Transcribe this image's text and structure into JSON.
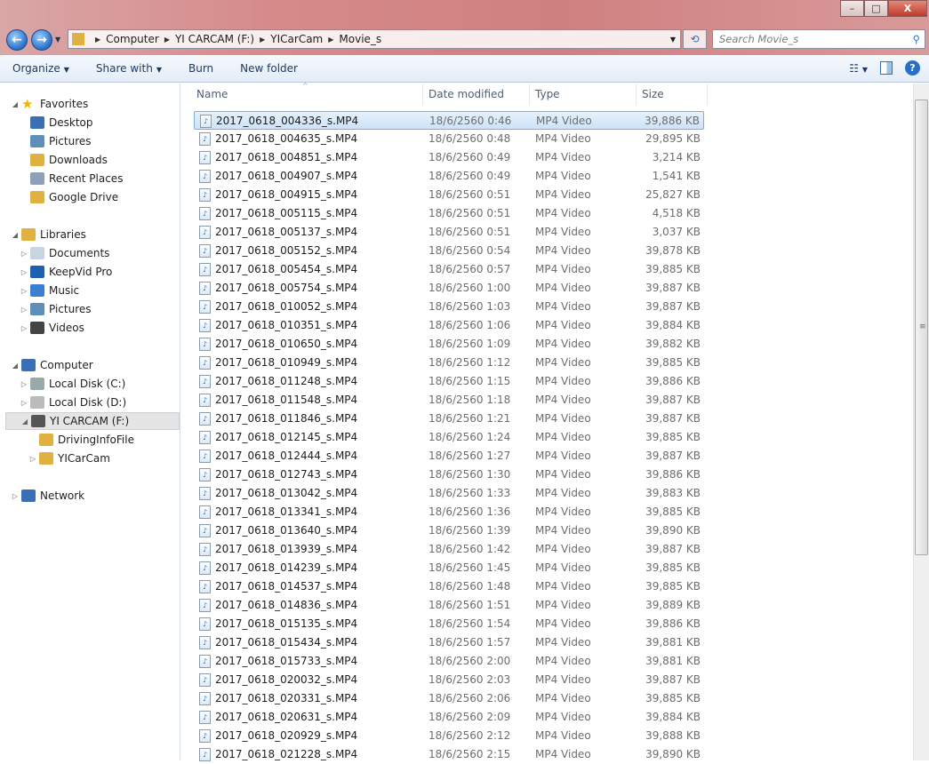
{
  "window": {
    "min": "–",
    "max": "□",
    "close": "X"
  },
  "nav": {
    "back": "←",
    "forward": "→"
  },
  "address": {
    "crumbs": [
      "Computer",
      "YI CARCAM (F:)",
      "YICarCam",
      "Movie_s"
    ]
  },
  "search": {
    "placeholder": "Search Movie_s"
  },
  "toolbar": {
    "organize": "Organize",
    "share": "Share with",
    "burn": "Burn",
    "new_folder": "New folder"
  },
  "sidebar": [
    {
      "label": "Favorites",
      "level": 0,
      "tri": "◢",
      "icon": "star",
      "color": "#f2b600",
      "gap": 0
    },
    {
      "label": "Desktop",
      "level": 1,
      "icon": "desktop",
      "color": "#3a6fb5"
    },
    {
      "label": "Pictures",
      "level": 1,
      "icon": "pictures",
      "color": "#5f8fb8"
    },
    {
      "label": "Downloads",
      "level": 1,
      "icon": "downloads",
      "color": "#e0b040"
    },
    {
      "label": "Recent Places",
      "level": 1,
      "icon": "recent",
      "color": "#8ca0b8"
    },
    {
      "label": "Google Drive",
      "level": 1,
      "icon": "folder",
      "color": "#e0b040"
    },
    {
      "label": "Libraries",
      "level": 0,
      "tri": "◢",
      "icon": "library",
      "color": "#e0b040",
      "gap": 1
    },
    {
      "label": "Documents",
      "level": 1,
      "tri": "▷",
      "icon": "documents",
      "color": "#c8d4e0"
    },
    {
      "label": "KeepVid Pro",
      "level": 1,
      "tri": "▷",
      "icon": "keepvid",
      "color": "#1f5fb0"
    },
    {
      "label": "Music",
      "level": 1,
      "tri": "▷",
      "icon": "music",
      "color": "#3a7fd0"
    },
    {
      "label": "Pictures",
      "level": 1,
      "tri": "▷",
      "icon": "pictures",
      "color": "#5f8fb8"
    },
    {
      "label": "Videos",
      "level": 1,
      "tri": "▷",
      "icon": "videos",
      "color": "#444"
    },
    {
      "label": "Computer",
      "level": 0,
      "tri": "◢",
      "icon": "computer",
      "color": "#3a6fb5",
      "gap": 1
    },
    {
      "label": "Local Disk (C:)",
      "level": 1,
      "tri": "▷",
      "icon": "drive",
      "color": "#9aa"
    },
    {
      "label": "Local Disk (D:)",
      "level": 1,
      "tri": "▷",
      "icon": "drive",
      "color": "#bbb"
    },
    {
      "label": "YI CARCAM (F:)",
      "level": 1,
      "tri": "◢",
      "icon": "usb-drive",
      "color": "#555",
      "selected": true
    },
    {
      "label": "DrivingInfoFile",
      "level": 2,
      "icon": "folder",
      "color": "#e0b040"
    },
    {
      "label": "YICarCam",
      "level": 2,
      "tri": "▷",
      "icon": "folder",
      "color": "#e0b040"
    },
    {
      "label": "Network",
      "level": 0,
      "tri": "▷",
      "icon": "network",
      "color": "#3a6fb5",
      "gap": 1
    }
  ],
  "columns": {
    "name": "Name",
    "date": "Date modified",
    "type": "Type",
    "size": "Size"
  },
  "files": [
    [
      "2017_0618_004336_s.MP4",
      "18/6/2560 0:46",
      "MP4 Video",
      "39,886 KB"
    ],
    [
      "2017_0618_004635_s.MP4",
      "18/6/2560 0:48",
      "MP4 Video",
      "29,895 KB"
    ],
    [
      "2017_0618_004851_s.MP4",
      "18/6/2560 0:49",
      "MP4 Video",
      "3,214 KB"
    ],
    [
      "2017_0618_004907_s.MP4",
      "18/6/2560 0:49",
      "MP4 Video",
      "1,541 KB"
    ],
    [
      "2017_0618_004915_s.MP4",
      "18/6/2560 0:51",
      "MP4 Video",
      "25,827 KB"
    ],
    [
      "2017_0618_005115_s.MP4",
      "18/6/2560 0:51",
      "MP4 Video",
      "4,518 KB"
    ],
    [
      "2017_0618_005137_s.MP4",
      "18/6/2560 0:51",
      "MP4 Video",
      "3,037 KB"
    ],
    [
      "2017_0618_005152_s.MP4",
      "18/6/2560 0:54",
      "MP4 Video",
      "39,878 KB"
    ],
    [
      "2017_0618_005454_s.MP4",
      "18/6/2560 0:57",
      "MP4 Video",
      "39,885 KB"
    ],
    [
      "2017_0618_005754_s.MP4",
      "18/6/2560 1:00",
      "MP4 Video",
      "39,887 KB"
    ],
    [
      "2017_0618_010052_s.MP4",
      "18/6/2560 1:03",
      "MP4 Video",
      "39,887 KB"
    ],
    [
      "2017_0618_010351_s.MP4",
      "18/6/2560 1:06",
      "MP4 Video",
      "39,884 KB"
    ],
    [
      "2017_0618_010650_s.MP4",
      "18/6/2560 1:09",
      "MP4 Video",
      "39,882 KB"
    ],
    [
      "2017_0618_010949_s.MP4",
      "18/6/2560 1:12",
      "MP4 Video",
      "39,885 KB"
    ],
    [
      "2017_0618_011248_s.MP4",
      "18/6/2560 1:15",
      "MP4 Video",
      "39,886 KB"
    ],
    [
      "2017_0618_011548_s.MP4",
      "18/6/2560 1:18",
      "MP4 Video",
      "39,887 KB"
    ],
    [
      "2017_0618_011846_s.MP4",
      "18/6/2560 1:21",
      "MP4 Video",
      "39,887 KB"
    ],
    [
      "2017_0618_012145_s.MP4",
      "18/6/2560 1:24",
      "MP4 Video",
      "39,885 KB"
    ],
    [
      "2017_0618_012444_s.MP4",
      "18/6/2560 1:27",
      "MP4 Video",
      "39,887 KB"
    ],
    [
      "2017_0618_012743_s.MP4",
      "18/6/2560 1:30",
      "MP4 Video",
      "39,886 KB"
    ],
    [
      "2017_0618_013042_s.MP4",
      "18/6/2560 1:33",
      "MP4 Video",
      "39,883 KB"
    ],
    [
      "2017_0618_013341_s.MP4",
      "18/6/2560 1:36",
      "MP4 Video",
      "39,885 KB"
    ],
    [
      "2017_0618_013640_s.MP4",
      "18/6/2560 1:39",
      "MP4 Video",
      "39,890 KB"
    ],
    [
      "2017_0618_013939_s.MP4",
      "18/6/2560 1:42",
      "MP4 Video",
      "39,887 KB"
    ],
    [
      "2017_0618_014239_s.MP4",
      "18/6/2560 1:45",
      "MP4 Video",
      "39,885 KB"
    ],
    [
      "2017_0618_014537_s.MP4",
      "18/6/2560 1:48",
      "MP4 Video",
      "39,885 KB"
    ],
    [
      "2017_0618_014836_s.MP4",
      "18/6/2560 1:51",
      "MP4 Video",
      "39,889 KB"
    ],
    [
      "2017_0618_015135_s.MP4",
      "18/6/2560 1:54",
      "MP4 Video",
      "39,886 KB"
    ],
    [
      "2017_0618_015434_s.MP4",
      "18/6/2560 1:57",
      "MP4 Video",
      "39,881 KB"
    ],
    [
      "2017_0618_015733_s.MP4",
      "18/6/2560 2:00",
      "MP4 Video",
      "39,881 KB"
    ],
    [
      "2017_0618_020032_s.MP4",
      "18/6/2560 2:03",
      "MP4 Video",
      "39,887 KB"
    ],
    [
      "2017_0618_020331_s.MP4",
      "18/6/2560 2:06",
      "MP4 Video",
      "39,885 KB"
    ],
    [
      "2017_0618_020631_s.MP4",
      "18/6/2560 2:09",
      "MP4 Video",
      "39,884 KB"
    ],
    [
      "2017_0618_020929_s.MP4",
      "18/6/2560 2:12",
      "MP4 Video",
      "39,888 KB"
    ],
    [
      "2017_0618_021228_s.MP4",
      "18/6/2560 2:15",
      "MP4 Video",
      "39,890 KB"
    ]
  ],
  "selected_index": 0
}
